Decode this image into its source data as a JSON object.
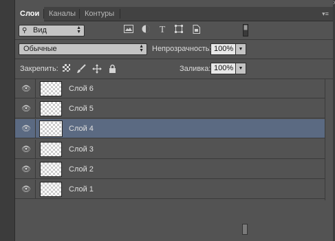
{
  "tabs": [
    {
      "label": "Слои",
      "active": true
    },
    {
      "label": "Каналы",
      "active": false
    },
    {
      "label": "Контуры",
      "active": false
    }
  ],
  "icons": {
    "close": "close-icon",
    "panel_menu": "panel-menu-icon",
    "search": "search-icon",
    "image_filter": "image-filter-icon",
    "adjustment_filter": "adjustment-filter-icon",
    "type_filter": "type-filter-icon",
    "shape_filter": "shape-filter-icon",
    "smart_object_filter": "smart-object-filter-icon",
    "filter_toggle": "filter-toggle-icon",
    "lock_pixels": "checkerboard-icon",
    "lock_paint": "brush-icon",
    "lock_position": "move-icon",
    "lock_all": "padlock-icon",
    "visibility": "eye-icon"
  },
  "filter": {
    "kind_value": "Вид"
  },
  "blend": {
    "mode_value": "Обычные",
    "opacity_label": "Непрозрачность:",
    "opacity_value": "100%"
  },
  "lock": {
    "label": "Закрепить:",
    "fill_label": "Заливка:",
    "fill_value": "100%"
  },
  "layers": [
    {
      "name": "Слой 6",
      "selected": false
    },
    {
      "name": "Слой 5",
      "selected": false
    },
    {
      "name": "Слой 4",
      "selected": true
    },
    {
      "name": "Слой 3",
      "selected": false
    },
    {
      "name": "Слой 2",
      "selected": false
    },
    {
      "name": "Слой 1",
      "selected": false
    }
  ],
  "colors": {
    "panel_bg": "#535353",
    "selected_layer": "#5b6a82",
    "tab_bar": "#424242"
  }
}
